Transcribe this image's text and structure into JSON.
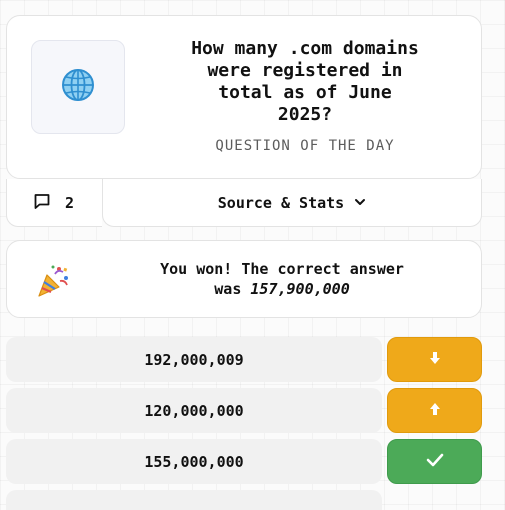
{
  "question": {
    "icon": "globe-icon",
    "lines": [
      "How many .com domains",
      "were registered in",
      "total as of June",
      "2025?"
    ],
    "subtitle": "QUESTION OF THE DAY"
  },
  "meta": {
    "comment_count": "2",
    "source_label": "Source & Stats"
  },
  "result": {
    "icon": "party-popper-icon",
    "line1": "You won! The correct answer",
    "line2_prefix": "was ",
    "answer": "157,900,000"
  },
  "guesses": [
    {
      "value": "192,000,009",
      "hint": "lower",
      "icon": "arrow-down-icon"
    },
    {
      "value": "120,000,000",
      "hint": "higher",
      "icon": "arrow-up-icon"
    },
    {
      "value": "155,000,000",
      "hint": "correct",
      "icon": "check-icon"
    }
  ],
  "colors": {
    "hint_yellow": "#efa91a",
    "correct_green": "#4caa58"
  }
}
